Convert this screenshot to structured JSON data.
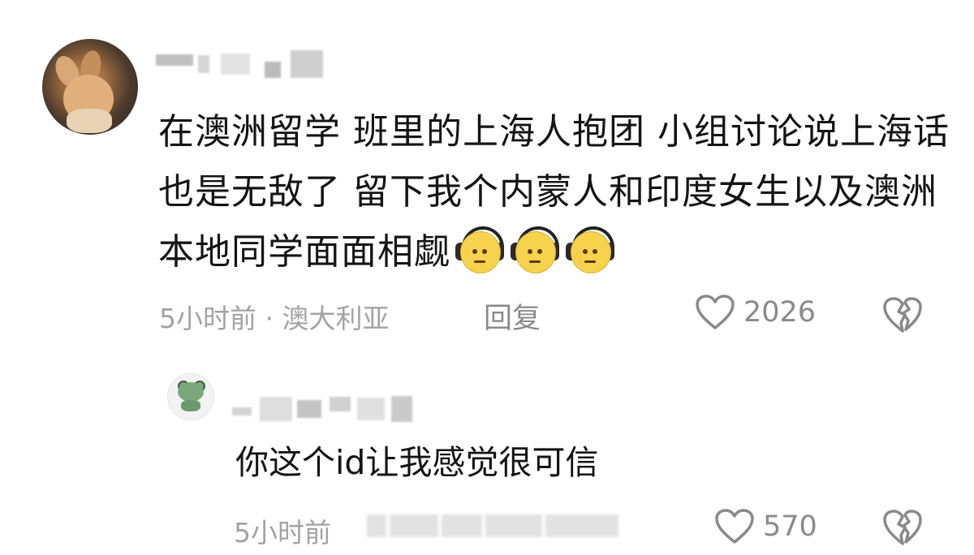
{
  "comment": {
    "text": "在澳洲留学 班里的上海人抱团 小组讨论说上海话也是无敌了 留下我个内蒙人和印度女生以及澳洲本地同学面面相觑",
    "emoji_icon": "headphones-face-emoji",
    "emoji_count": 3,
    "meta": "5小时前 · 澳大利亚",
    "reply_label": "回复",
    "like_count": "2026",
    "like_icon": "heart-outline-icon",
    "dislike_icon": "broken-heart-icon"
  },
  "reply": {
    "text": "你这个id让我感觉很可信",
    "meta": "5小时前",
    "like_count": "570",
    "like_icon": "heart-outline-icon",
    "dislike_icon": "broken-heart-icon"
  },
  "colors": {
    "text": "#141414",
    "meta": "#a3a3a3",
    "icon": "#8a8a8a",
    "emoji": "#f7d24d"
  }
}
